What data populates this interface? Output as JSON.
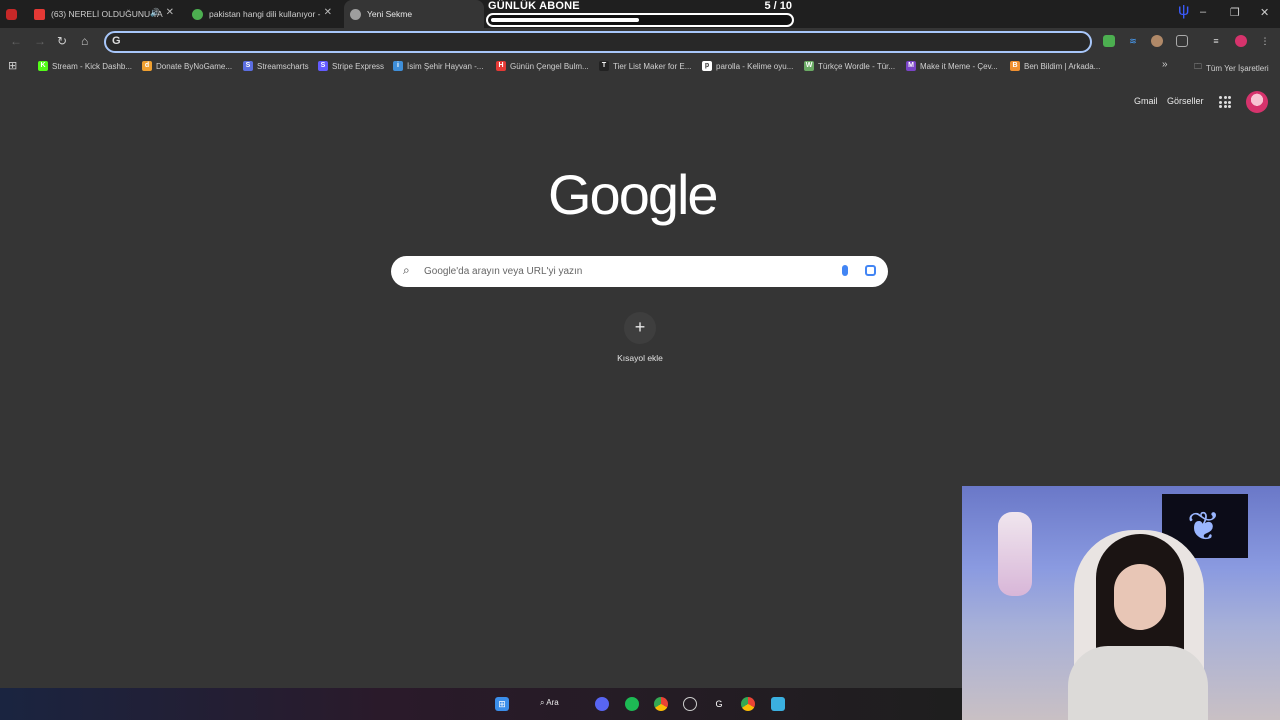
{
  "tabs": [
    {
      "label": "(63) NERELİ OLDUĞUNU TA",
      "fav_color": "#e53935"
    },
    {
      "label": "pakistan hangi dili kullanıyor - ",
      "fav_color": "#4caf50"
    },
    {
      "label": "Yeni Sekme",
      "fav_color": "#9e9e9e"
    }
  ],
  "overlay": {
    "title": "GÜNLÜK ABONE",
    "count": "5 / 10",
    "progress": 0.5
  },
  "omnibox": {
    "value": "",
    "g_icon": "G"
  },
  "bookmarks": [
    {
      "label": "Stream - Kick Dashb...",
      "icon": "K",
      "color": "#53fc18"
    },
    {
      "label": "Donate ByNoGame...",
      "icon": "d",
      "color": "#f0a030"
    },
    {
      "label": "Streamscharts",
      "icon": "S",
      "color": "#5b6ee1"
    },
    {
      "label": "Stripe Express",
      "icon": "S",
      "color": "#635bff"
    },
    {
      "label": "İsim Şehir Hayvan -...",
      "icon": "i",
      "color": "#3f8fd9"
    },
    {
      "label": "Günün Çengel Bulm...",
      "icon": "H",
      "color": "#e53935"
    },
    {
      "label": "Tier List Maker for E...",
      "icon": "T",
      "color": "#222222"
    },
    {
      "label": "parolla - Kelime oyu...",
      "icon": "p",
      "color": "#ffffff"
    },
    {
      "label": "Türkçe Wordle - Tür...",
      "icon": "W",
      "color": "#6aaa64"
    },
    {
      "label": "Make it Meme - Çev...",
      "icon": "M",
      "color": "#7a44c7"
    },
    {
      "label": "Ben Bildim | Arkada...",
      "icon": "B",
      "color": "#f09030"
    }
  ],
  "bookmarks_more": "»",
  "all_bookmarks": "Tüm Yer İşaretleri",
  "ntp": {
    "gmail": "Gmail",
    "images": "Görseller",
    "logo": "Google",
    "search_placeholder": "Google'da arayın veya URL'yi yazın",
    "shortcut_plus": "+",
    "shortcut_label": "Kısayol ekle"
  },
  "taskbar": {
    "search_label": "Ara"
  },
  "icons": [
    "tab-favicon",
    "close-icon",
    "back-icon",
    "forward-icon",
    "reload-icon",
    "home-icon",
    "apps-grid-icon",
    "folder-icon",
    "search-icon",
    "mic-icon",
    "lens-icon",
    "windows-start-icon"
  ]
}
